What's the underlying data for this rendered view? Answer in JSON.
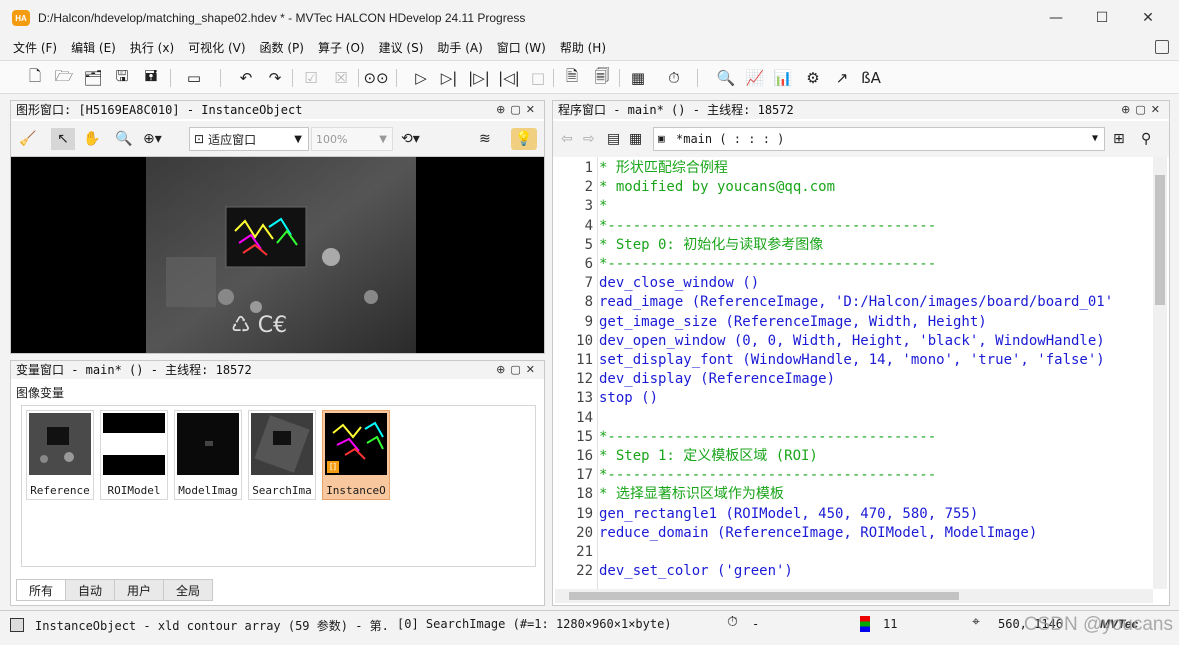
{
  "window": {
    "app_icon": "HA",
    "title": "D:/Halcon/hdevelop/matching_shape02.hdev * - MVTec HALCON HDevelop 24.11 Progress",
    "minimize": "—",
    "maximize": "☐",
    "close": "✕"
  },
  "menu": [
    "文件 (F)",
    "编辑 (E)",
    "执行 (x)",
    "可视化 (V)",
    "函数 (P)",
    "算子 (O)",
    "建议 (S)",
    "助手 (A)",
    "窗口 (W)",
    "帮助 (H)"
  ],
  "graphics_window": {
    "title": "图形窗口: [H5169EA8C010] - InstanceObject",
    "fit_label": "适应窗口",
    "zoom_label": "100%"
  },
  "variable_window": {
    "title": "变量窗口 - main* () - 主线程: 18572",
    "section_label": "图像变量",
    "thumbnails": [
      {
        "label": "Reference"
      },
      {
        "label": "ROIModel"
      },
      {
        "label": "ModelImag"
      },
      {
        "label": "SearchIma"
      },
      {
        "label": "InstanceO",
        "selected": true,
        "badge": "[]"
      }
    ],
    "tabs": [
      {
        "label": "所有",
        "active": true
      },
      {
        "label": "自动"
      },
      {
        "label": "用户"
      },
      {
        "label": "全局"
      }
    ]
  },
  "program_window": {
    "title": "程序窗口 - main* () - 主线程: 18572",
    "procedure": "*main ( : : : )",
    "lines": [
      {
        "n": "1",
        "text": "* 形状匹配综合例程",
        "kind": "comment"
      },
      {
        "n": "2",
        "text": "* modified by youcans@qq.com",
        "kind": "comment"
      },
      {
        "n": "3",
        "text": "*",
        "kind": "comment"
      },
      {
        "n": "4",
        "text": "*---------------------------------------",
        "kind": "comment"
      },
      {
        "n": "5",
        "text": "* Step 0: 初始化与读取参考图像",
        "kind": "comment"
      },
      {
        "n": "6",
        "text": "*---------------------------------------",
        "kind": "comment"
      },
      {
        "n": "7",
        "text": "dev_close_window ()",
        "kind": "op"
      },
      {
        "n": "8",
        "text": "read_image (ReferenceImage, 'D:/Halcon/images/board/board_01'",
        "kind": "op"
      },
      {
        "n": "9",
        "text": "get_image_size (ReferenceImage, Width, Height)",
        "kind": "op"
      },
      {
        "n": "10",
        "text": "dev_open_window (0, 0, Width, Height, 'black', WindowHandle)",
        "kind": "op"
      },
      {
        "n": "11",
        "text": "set_display_font (WindowHandle, 14, 'mono', 'true', 'false')",
        "kind": "op"
      },
      {
        "n": "12",
        "text": "dev_display (ReferenceImage)",
        "kind": "op"
      },
      {
        "n": "13",
        "text": "stop ()",
        "kind": "op"
      },
      {
        "n": "14",
        "text": "",
        "kind": "op"
      },
      {
        "n": "15",
        "text": "*---------------------------------------",
        "kind": "comment"
      },
      {
        "n": "16",
        "text": "* Step 1: 定义模板区域 (ROI)",
        "kind": "comment"
      },
      {
        "n": "17",
        "text": "*---------------------------------------",
        "kind": "comment"
      },
      {
        "n": "18",
        "text": "* 选择显著标识区域作为模板",
        "kind": "comment"
      },
      {
        "n": "19",
        "text": "gen_rectangle1 (ROIModel, 450, 470, 580, 755)",
        "kind": "op"
      },
      {
        "n": "20",
        "text": "reduce_domain (ReferenceImage, ROIModel, ModelImage)",
        "kind": "op"
      },
      {
        "n": "21",
        "text": "",
        "kind": "op"
      },
      {
        "n": "22",
        "text": "dev_set_color ('green')",
        "kind": "op"
      }
    ]
  },
  "status": {
    "object_info": "InstanceObject - xld contour array (59 参数) - 第...",
    "image_info": "[0] SearchImage (#=1: 1280×960×1×byte)",
    "timer": "-",
    "color_count": "11",
    "coords": "560, 1146",
    "brand": "MVTec",
    "watermark": "CSDN @youcans"
  }
}
